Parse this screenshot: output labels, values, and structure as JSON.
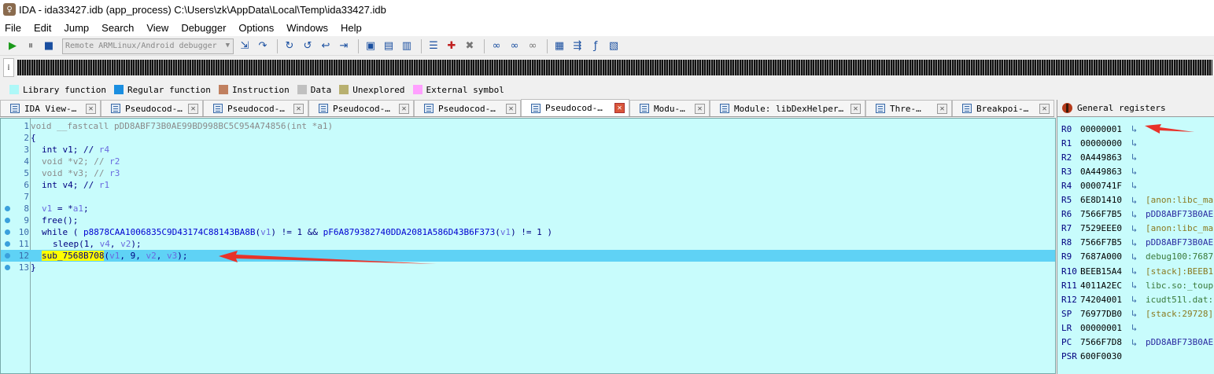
{
  "window": {
    "title": "IDA - ida33427.idb (app_process) C:\\Users\\zk\\AppData\\Local\\Temp\\ida33427.idb"
  },
  "menu": [
    "File",
    "Edit",
    "Jump",
    "Search",
    "View",
    "Debugger",
    "Options",
    "Windows",
    "Help"
  ],
  "toolbar": {
    "debugger_selected": "Remote ARMLinux/Android debugger"
  },
  "legend": [
    {
      "label": "Library function",
      "color": "#aef8f8"
    },
    {
      "label": "Regular function",
      "color": "#1a8ee0"
    },
    {
      "label": "Instruction",
      "color": "#c08060"
    },
    {
      "label": "Data",
      "color": "#c0c0c0"
    },
    {
      "label": "Unexplored",
      "color": "#b8b070"
    },
    {
      "label": "External symbol",
      "color": "#ffa0ff"
    }
  ],
  "tabs": [
    {
      "label": "IDA View-…",
      "active": false
    },
    {
      "label": "Pseudocod-…",
      "active": false
    },
    {
      "label": "Pseudocod-…",
      "active": false
    },
    {
      "label": "Pseudocod-…",
      "active": false
    },
    {
      "label": "Pseudocod-…",
      "active": false
    },
    {
      "label": "Pseudocod-…",
      "active": true
    },
    {
      "label": "Modu-…",
      "active": false
    },
    {
      "label": "Module: libDexHelper…",
      "active": false
    },
    {
      "label": "Thre-…",
      "active": false
    },
    {
      "label": "Breakpoi-…",
      "active": false
    }
  ],
  "code": {
    "line1": "void __fastcall pDD8ABF73B0AE99BD998BC5C954A74856(int *a1)",
    "line2": "{",
    "l3_kw": "int v1; //",
    "l3_reg": " r4",
    "l4_kw": "void *v2; //",
    "l4_reg": " r2",
    "l5_kw": "void *v3; //",
    "l5_reg": " r3",
    "l6_kw": "int v4; //",
    "l6_reg": " r1",
    "l8_a": "v1",
    "l8_b": " = *",
    "l8_c": "a1",
    "l8_d": ";",
    "l9": "free();",
    "l10_a": "while ( ",
    "l10_f1": "p8878CAA1006835C9D43174C88143BA8B",
    "l10_b": "(",
    "l10_v1": "v1",
    "l10_c": ") != 1 && ",
    "l10_f2": "pF6A879382740DDA2081A586D43B6F373",
    "l10_d": "(",
    "l10_v2": "v1",
    "l10_e": ") != 1 )",
    "l11_a": "sleep(1, ",
    "l11_v1": "v4",
    "l11_b": ", ",
    "l11_v2": "v2",
    "l11_c": ");",
    "l12_fn": "sub_7568B708",
    "l12_a": "(",
    "l12_v1": "v1",
    "l12_b": ", 9, ",
    "l12_v2": "v2",
    "l12_c": ", ",
    "l12_v3": "v3",
    "l12_d": ");",
    "line13": "}",
    "line_numbers": [
      "1",
      "2",
      "3",
      "4",
      "5",
      "6",
      "7",
      "8",
      "9",
      "10",
      "11",
      "12",
      "13"
    ]
  },
  "registers": {
    "title": "General registers",
    "rows": [
      {
        "name": "R0",
        "value": "00000001",
        "ref": ""
      },
      {
        "name": "R1",
        "value": "00000000",
        "ref": ""
      },
      {
        "name": "R2",
        "value": "0A449863",
        "ref": ""
      },
      {
        "name": "R3",
        "value": "0A449863",
        "ref": ""
      },
      {
        "name": "R4",
        "value": "0000741F",
        "ref": ""
      },
      {
        "name": "R5",
        "value": "6E8D1410",
        "ref": "[anon:libc_ma"
      },
      {
        "name": "R6",
        "value": "7566F7B5",
        "ref": "pDD8ABF73B0AE"
      },
      {
        "name": "R7",
        "value": "7529EEE0",
        "ref": "[anon:libc_ma"
      },
      {
        "name": "R8",
        "value": "7566F7B5",
        "ref": "pDD8ABF73B0AE"
      },
      {
        "name": "R9",
        "value": "7687A000",
        "ref": "debug100:7687"
      },
      {
        "name": "R10",
        "value": "BEEB15A4",
        "ref": "[stack]:BEEB1"
      },
      {
        "name": "R11",
        "value": "4011A2EC",
        "ref": "libc.so:_toup"
      },
      {
        "name": "R12",
        "value": "74204001",
        "ref": "icudt51l.dat:"
      },
      {
        "name": "SP",
        "value": "76977DB0",
        "ref": "[stack:29728]"
      },
      {
        "name": "LR",
        "value": "00000001",
        "ref": ""
      },
      {
        "name": "PC",
        "value": "7566F7D8",
        "ref": "pDD8ABF73B0AE"
      },
      {
        "name": "PSR",
        "value": "600F0030",
        "ref": ""
      }
    ]
  }
}
